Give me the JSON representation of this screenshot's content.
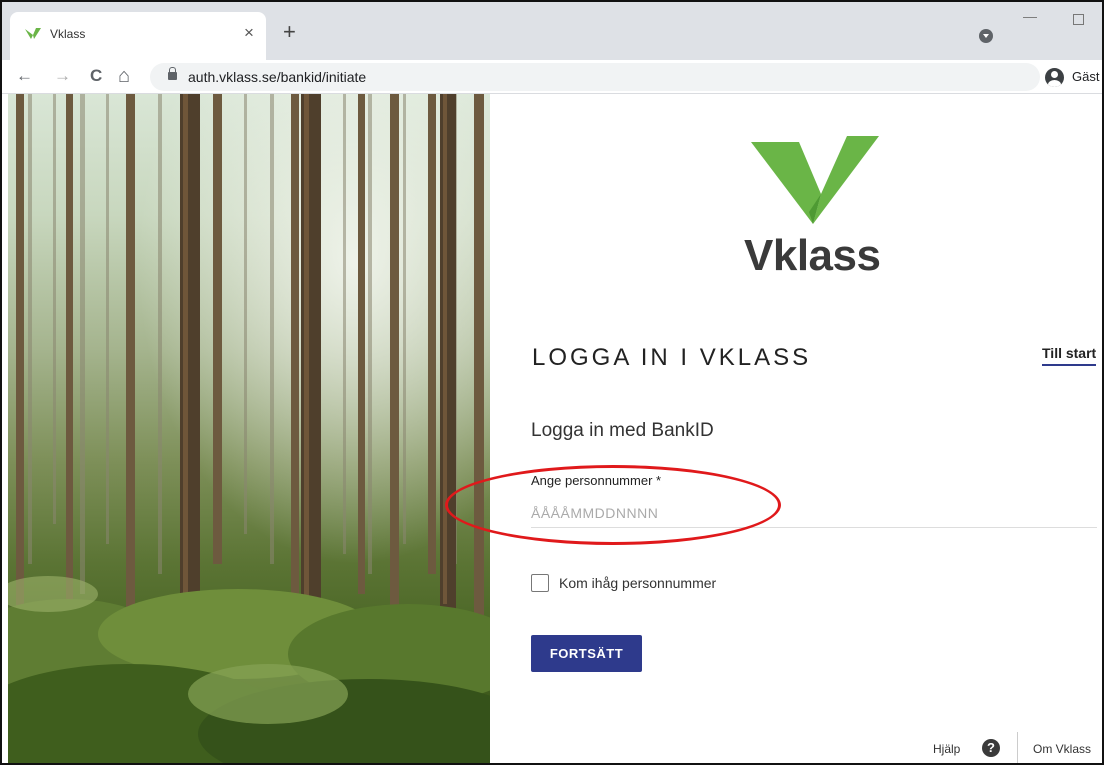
{
  "browser": {
    "tab_title": "Vklass",
    "tab_close": "×",
    "new_tab": "+",
    "url": "auth.vklass.se/bankid/initiate",
    "profile_label": "Gäst",
    "back": "←",
    "forward": "→",
    "reload": "C",
    "home": "⌂",
    "minimize": "—"
  },
  "brand": {
    "name": "Vklass",
    "green": "#6ab547",
    "dark_green": "#4e9a33"
  },
  "login": {
    "title": "LOGGA IN I VKLASS",
    "till_start": "Till start",
    "subtitle": "Logga in med BankID",
    "field_label": "Ange personnummer *",
    "field_placeholder": "ÅÅÅÅMMDDNNNN",
    "field_value": "",
    "remember_label": "Kom ihåg personnummer",
    "remember_checked": false,
    "continue_label": "FORTSÄTT",
    "button_color": "#2e3a8c"
  },
  "footer": {
    "help_label": "Hjälp",
    "help_icon": "?",
    "about_label": "Om Vklass"
  },
  "annotation": {
    "highlight_color": "#e0191b"
  }
}
